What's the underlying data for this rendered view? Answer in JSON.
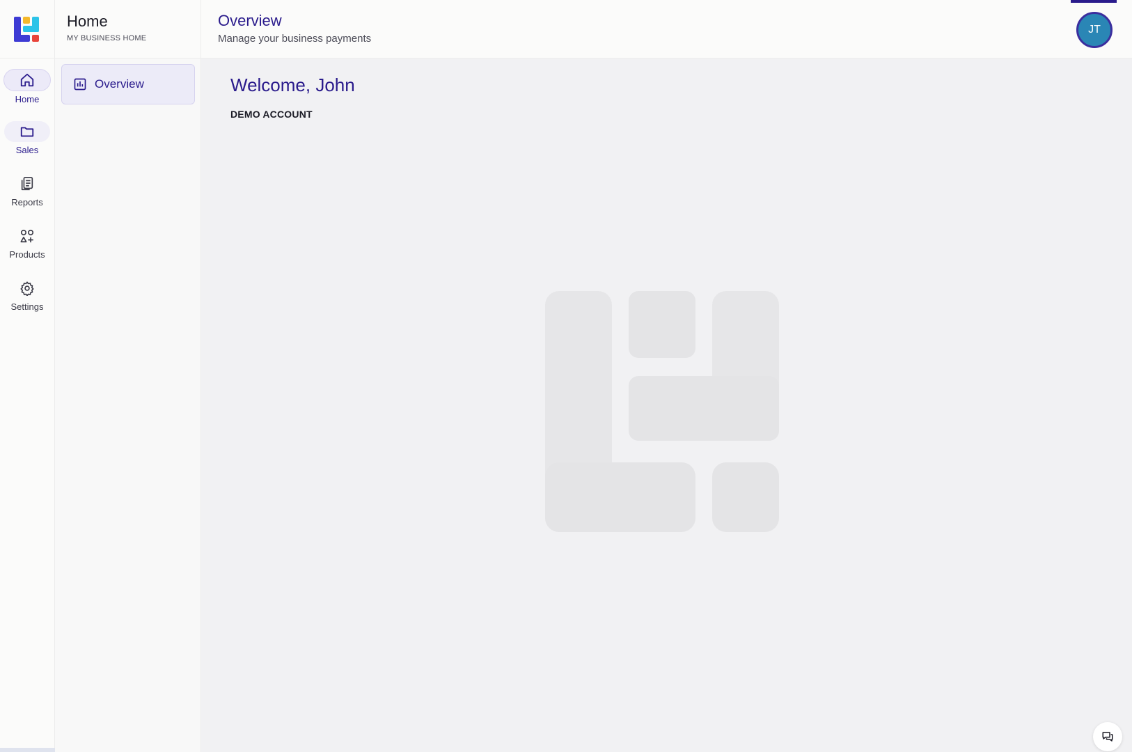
{
  "rail": {
    "items": [
      {
        "label": "Home",
        "icon": "home-icon"
      },
      {
        "label": "Sales",
        "icon": "folder-icon"
      },
      {
        "label": "Reports",
        "icon": "reports-icon"
      },
      {
        "label": "Products",
        "icon": "products-icon"
      },
      {
        "label": "Settings",
        "icon": "gear-icon"
      }
    ]
  },
  "panel": {
    "title": "Home",
    "subtitle": "MY BUSINESS HOME",
    "items": [
      {
        "label": "Overview",
        "icon": "chart-icon"
      }
    ]
  },
  "header": {
    "title": "Overview",
    "subtitle": "Manage your business payments",
    "avatar_initials": "JT"
  },
  "main": {
    "welcome": "Welcome, John",
    "account_type": "DEMO ACCOUNT"
  },
  "colors": {
    "accent": "#2a1b8c",
    "avatar_bg": "#2a86b5",
    "logo_blue": "#3d3bd4",
    "logo_cyan": "#2cc3e8",
    "logo_yellow": "#f5b82a",
    "logo_red": "#e8443a"
  }
}
